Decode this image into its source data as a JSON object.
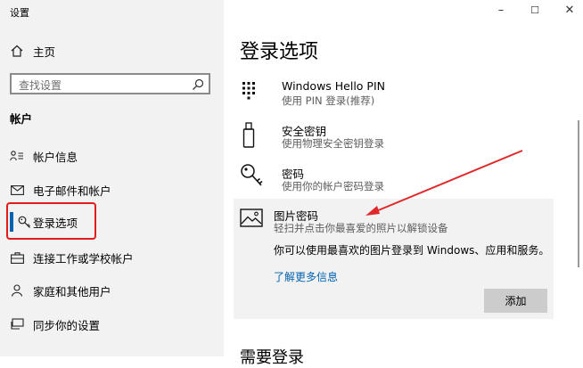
{
  "window": {
    "title": "设置",
    "controls": [
      "–",
      "☐",
      "✕"
    ]
  },
  "sidebar": {
    "home_label": "主页",
    "search_placeholder": "查找设置",
    "section_title": "帐户",
    "items": [
      {
        "label": "帐户信息",
        "icon": "account-info-icon"
      },
      {
        "label": "电子邮件和帐户",
        "icon": "mail-icon"
      },
      {
        "label": "登录选项",
        "icon": "key-icon",
        "selected": true
      },
      {
        "label": "连接工作或学校帐户",
        "icon": "briefcase-icon"
      },
      {
        "label": "家庭和其他用户",
        "icon": "person-icon"
      },
      {
        "label": "同步你的设置",
        "icon": "sync-icon"
      }
    ]
  },
  "main": {
    "title": "登录选项",
    "options": [
      {
        "title": "Windows Hello PIN",
        "subtitle": "使用 PIN 登录(推荐)",
        "icon": "pin-keypad-icon"
      },
      {
        "title": "安全密钥",
        "subtitle": "使用物理安全密钥登录",
        "icon": "usb-key-icon"
      },
      {
        "title": "密码",
        "subtitle": "使用你的帐户密码登录",
        "icon": "key-icon"
      },
      {
        "title": "图片密码",
        "subtitle": "轻扫并点击你最喜爱的照片以解锁设备",
        "icon": "picture-icon"
      }
    ],
    "picture_description": "你可以使用最喜欢的图片登录到 Windows、应用和服务。",
    "learn_more": "了解更多信息",
    "add_button": "添加",
    "next_section": "需要登录"
  },
  "colors": {
    "accent": "#0063b1",
    "highlight_box": "#e21c1c",
    "arrow": "#e0282a",
    "sidebar_bg": "#f2f2f2"
  }
}
